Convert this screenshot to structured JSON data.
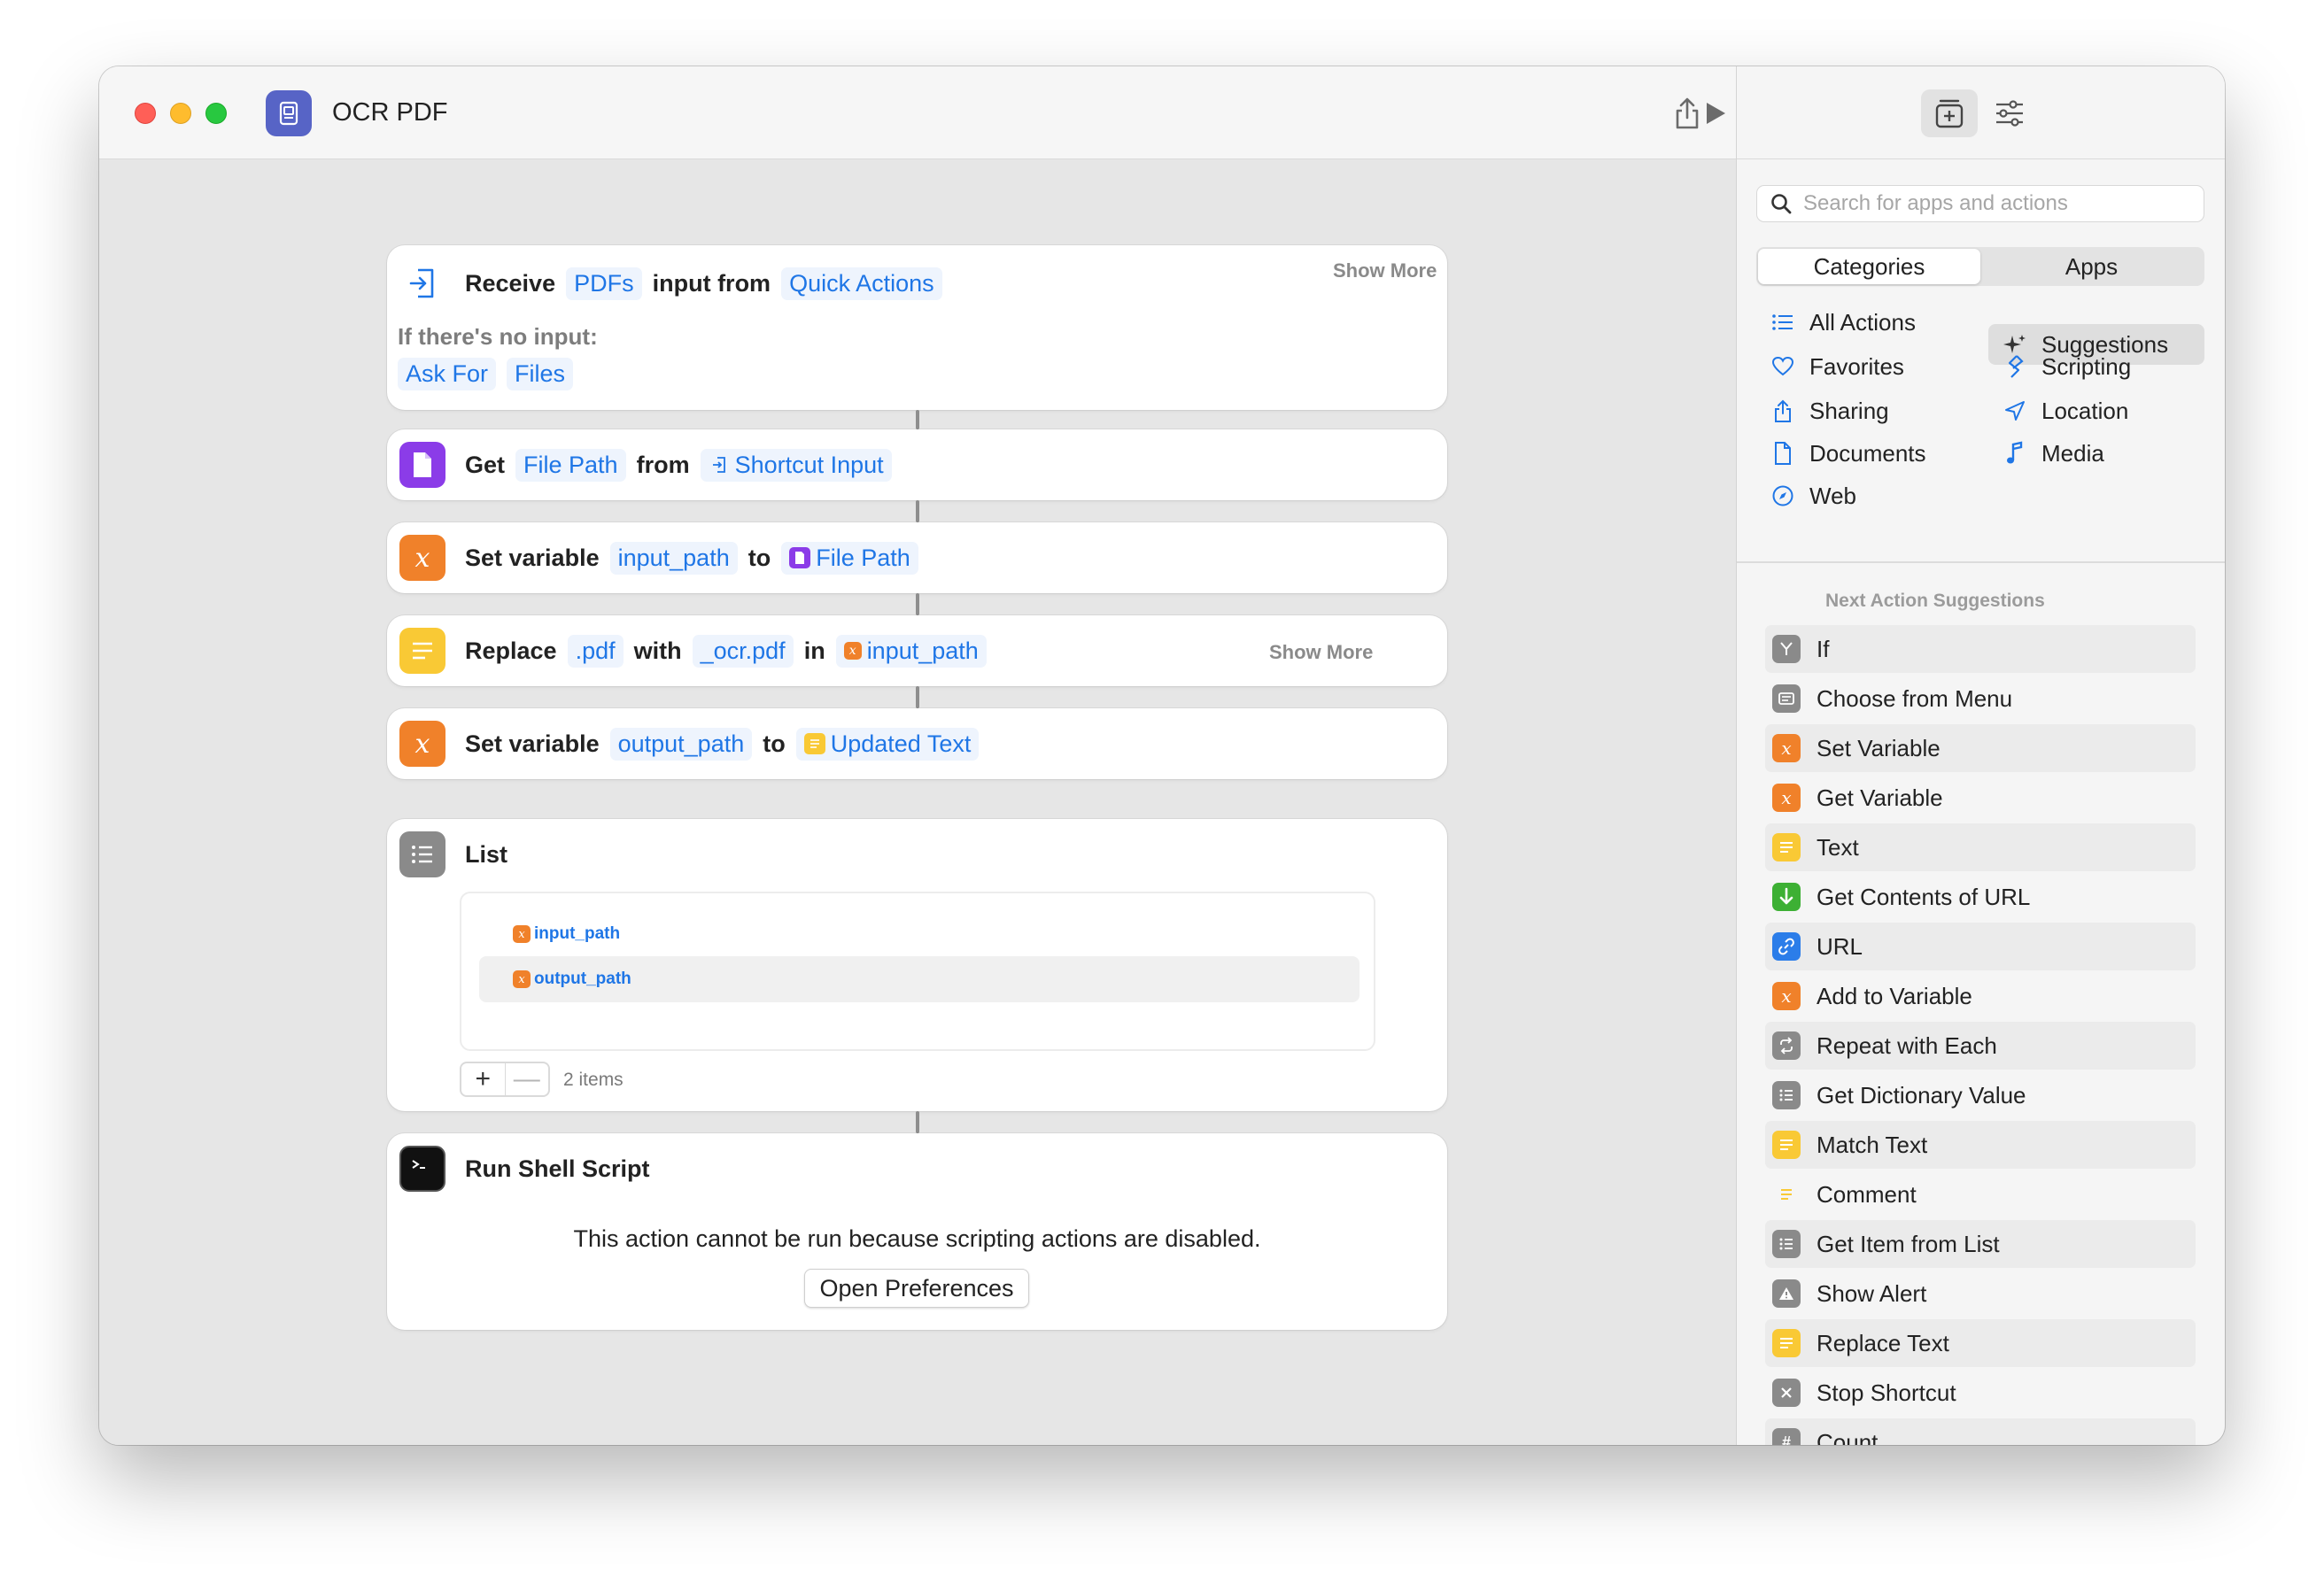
{
  "window": {
    "title": "OCR PDF"
  },
  "actions": {
    "receive": {
      "kw_receive": "Receive",
      "tok_pdfs": "PDFs",
      "kw_input_from": "input from",
      "tok_source": "Quick Actions",
      "show_more": "Show More",
      "no_input_label": "If there's no input:",
      "tok_ask_for": "Ask For",
      "tok_files": "Files"
    },
    "get_file_path": {
      "kw_get": "Get",
      "tok_file_path": "File Path",
      "kw_from": "from",
      "tok_shortcut_input": "Shortcut Input"
    },
    "set_input_path": {
      "kw_set": "Set variable",
      "tok_var": "input_path",
      "kw_to": "to",
      "tok_value": "File Path"
    },
    "replace": {
      "kw_replace": "Replace",
      "tok_find": ".pdf",
      "kw_with": "with",
      "tok_replace": "_ocr.pdf",
      "kw_in": "in",
      "tok_in": "input_path",
      "show_more": "Show More"
    },
    "set_output_path": {
      "kw_set": "Set variable",
      "tok_var": "output_path",
      "kw_to": "to",
      "tok_value": "Updated Text"
    },
    "list": {
      "title": "List",
      "items": [
        "input_path",
        "output_path"
      ],
      "count_label": "2 items",
      "add": "+",
      "remove": "—"
    },
    "run_shell": {
      "title": "Run Shell Script",
      "warning": "This action cannot be run because scripting actions are disabled.",
      "button": "Open Preferences"
    }
  },
  "sidebar": {
    "search_placeholder": "Search for apps and actions",
    "segments": [
      "Categories",
      "Apps"
    ],
    "categories_left": [
      "All Actions",
      "Favorites",
      "Sharing",
      "Documents",
      "Web"
    ],
    "categories_right": [
      "Suggestions",
      "Scripting",
      "Location",
      "Media"
    ],
    "suggestions_heading": "Next Action Suggestions",
    "suggestions": [
      "If",
      "Choose from Menu",
      "Set Variable",
      "Get Variable",
      "Text",
      "Get Contents of URL",
      "URL",
      "Add to Variable",
      "Repeat with Each",
      "Get Dictionary Value",
      "Match Text",
      "Comment",
      "Get Item from List",
      "Show Alert",
      "Replace Text",
      "Stop Shortcut",
      "Count"
    ]
  },
  "colors": {
    "accent": "#1f76e6",
    "variable": "#f0812a",
    "text": "#f9c935",
    "files": "#8b3ce8",
    "scripting": "#7d7d7d",
    "web": "#3db034"
  }
}
